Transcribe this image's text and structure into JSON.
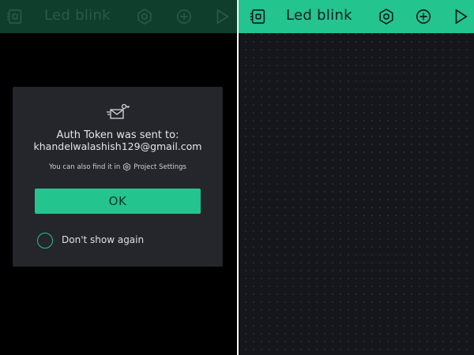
{
  "left_screen": {
    "title": "Led blink",
    "dialog": {
      "title": "Auth Token was sent to:",
      "email": "khandelwalashish129@gmail.com",
      "hint_prefix": "You can also find it in",
      "hint_link": "Project Settings",
      "ok_label": "OK",
      "checkbox_label": "Don't show again",
      "checkbox_checked": false
    }
  },
  "right_screen": {
    "title": "Led blink"
  },
  "icons": [
    "device-icon",
    "settings-nut-icon",
    "add-widget-icon",
    "play-icon",
    "mail-key-icon",
    "nut-small-icon"
  ],
  "colors": {
    "accent": "#23c48e",
    "topbar_dimmed": "#0f3f2c",
    "dialog_bg": "#24262b",
    "canvas_bg": "#14161b"
  }
}
